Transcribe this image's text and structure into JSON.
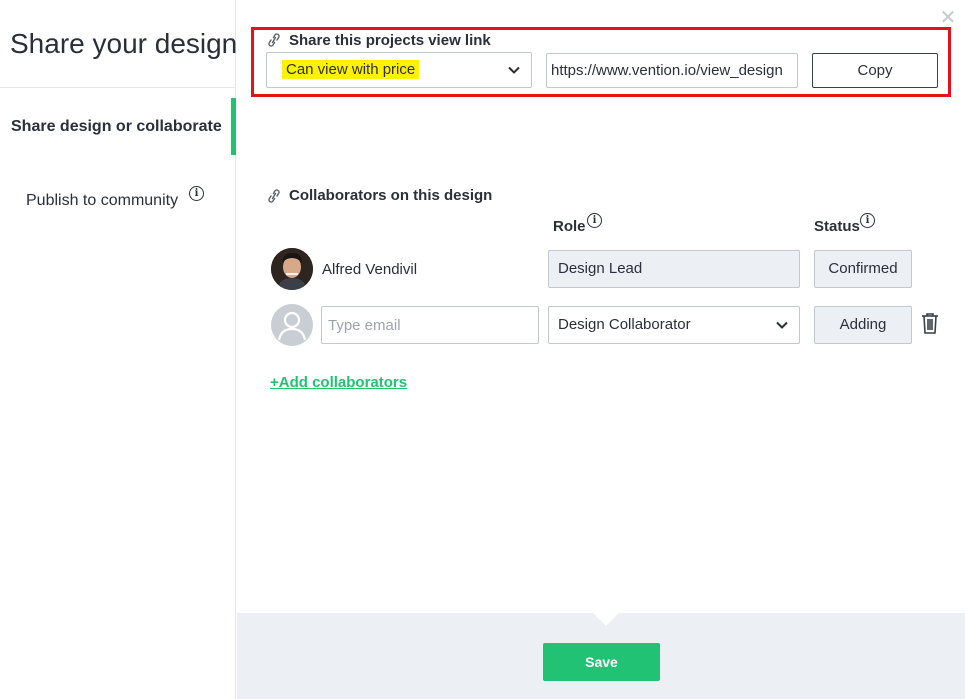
{
  "sidebar": {
    "title": "Share your design",
    "items": [
      {
        "label": "Share design or collaborate",
        "active": true
      },
      {
        "label": "Publish to community"
      }
    ]
  },
  "share_link": {
    "title": "Share this projects view link",
    "permission_value": "Can view with price",
    "url": "https://www.vention.io/view_design",
    "copy_label": "Copy"
  },
  "collaborators": {
    "title": "Collaborators on this design",
    "role_header": "Role",
    "status_header": "Status",
    "rows": [
      {
        "name": "Alfred Vendivil",
        "role": "Design Lead",
        "status": "Confirmed"
      }
    ],
    "new_row": {
      "email_placeholder": "Type email",
      "role": "Design Collaborator",
      "status": "Adding"
    },
    "add_label": "+Add collaborators"
  },
  "footer": {
    "save_label": "Save"
  },
  "colors": {
    "accent_green": "#22c274",
    "highlight_red": "#e3131b",
    "highlight_yellow": "#fff200"
  }
}
